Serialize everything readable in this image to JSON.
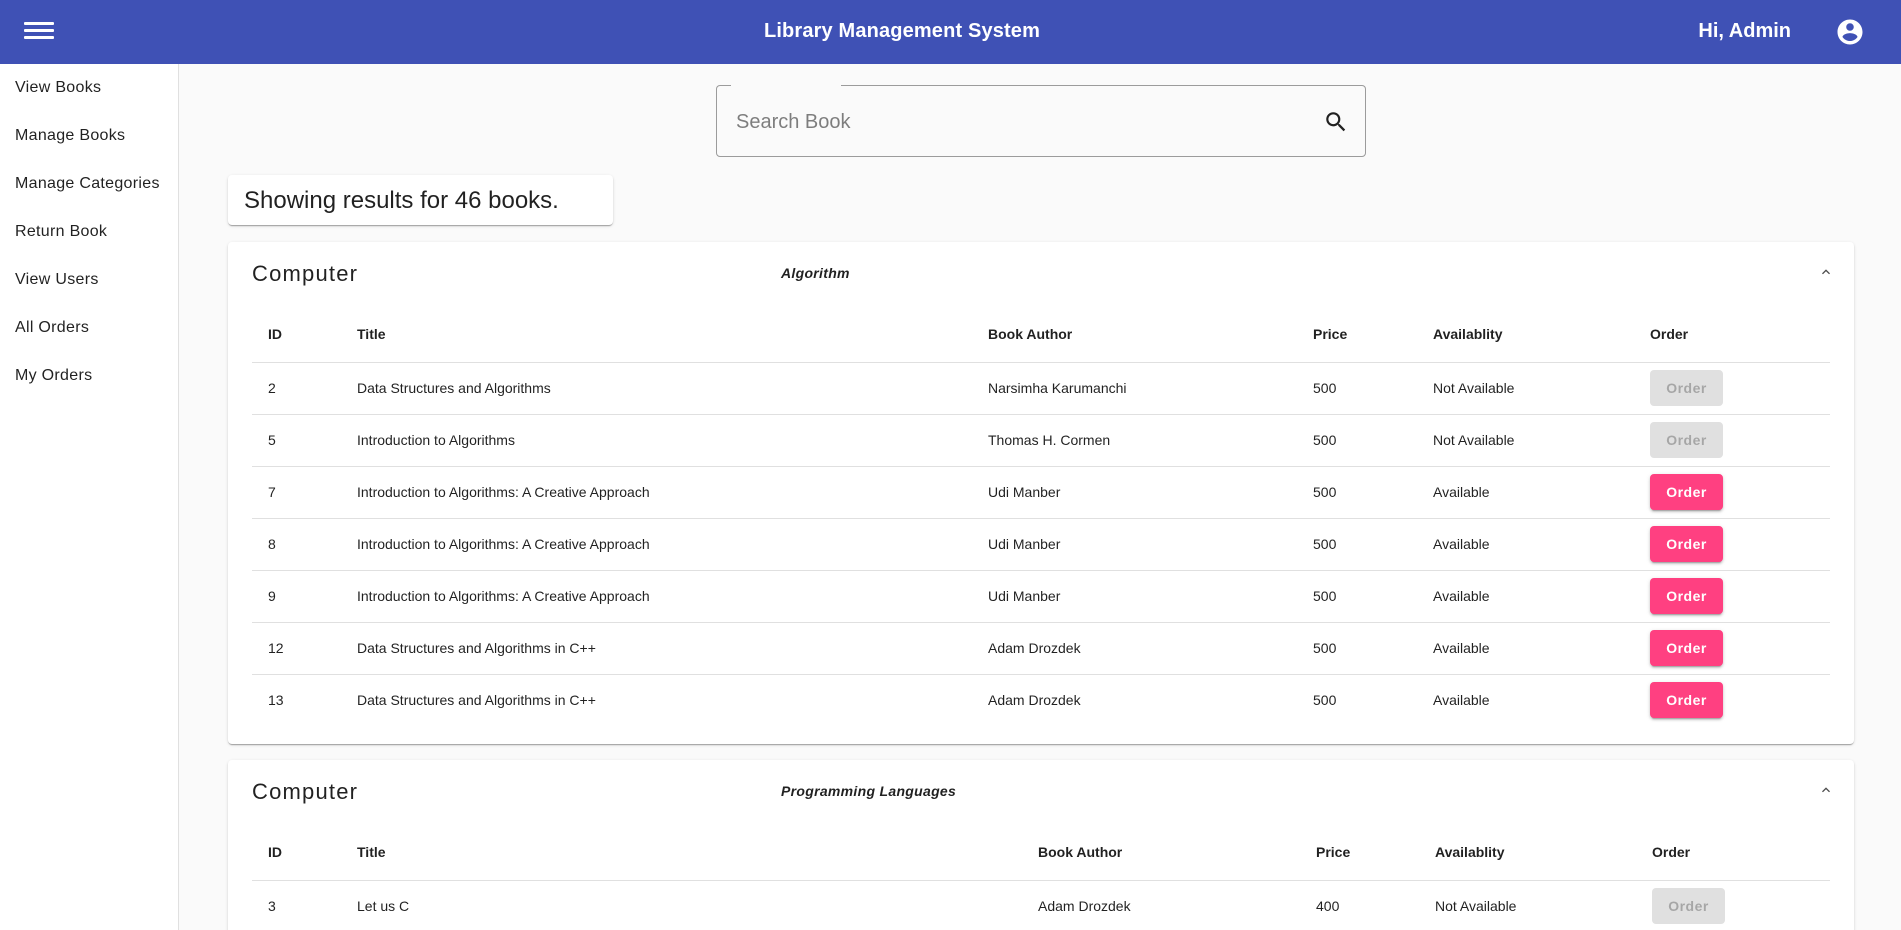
{
  "header": {
    "title": "Library Management System",
    "greeting": "Hi, Admin",
    "background": "#3f51b5"
  },
  "sidebar": {
    "items": [
      {
        "label": "View Books"
      },
      {
        "label": "Manage Books"
      },
      {
        "label": "Manage Categories"
      },
      {
        "label": "Return Book"
      },
      {
        "label": "View Users"
      },
      {
        "label": "All Orders"
      },
      {
        "label": "My Orders"
      }
    ]
  },
  "search": {
    "placeholder": "Search Book",
    "value": ""
  },
  "results": {
    "text": "Showing results for 46 books."
  },
  "sections": [
    {
      "category": "Computer",
      "subcategory": "Algorithm",
      "columns": [
        "ID",
        "Title",
        "Book Author",
        "Price",
        "Availablity",
        "Order"
      ],
      "rows": [
        {
          "id": "2",
          "title": "Data Structures and Algorithms",
          "author": "Narsimha Karumanchi",
          "price": "500",
          "availability": "Not Available",
          "order_label": "Order",
          "order_enabled": false
        },
        {
          "id": "5",
          "title": "Introduction to Algorithms",
          "author": "Thomas H. Cormen",
          "price": "500",
          "availability": "Not Available",
          "order_label": "Order",
          "order_enabled": false
        },
        {
          "id": "7",
          "title": "Introduction to Algorithms: A Creative Approach",
          "author": "Udi Manber",
          "price": "500",
          "availability": "Available",
          "order_label": "Order",
          "order_enabled": true
        },
        {
          "id": "8",
          "title": "Introduction to Algorithms: A Creative Approach",
          "author": "Udi Manber",
          "price": "500",
          "availability": "Available",
          "order_label": "Order",
          "order_enabled": true
        },
        {
          "id": "9",
          "title": "Introduction to Algorithms: A Creative Approach",
          "author": "Udi Manber",
          "price": "500",
          "availability": "Available",
          "order_label": "Order",
          "order_enabled": true
        },
        {
          "id": "12",
          "title": "Data Structures and Algorithms in C++",
          "author": "Adam Drozdek",
          "price": "500",
          "availability": "Available",
          "order_label": "Order",
          "order_enabled": true
        },
        {
          "id": "13",
          "title": "Data Structures and Algorithms in C++",
          "author": "Adam Drozdek",
          "price": "500",
          "availability": "Available",
          "order_label": "Order",
          "order_enabled": true
        }
      ]
    },
    {
      "category": "Computer",
      "subcategory": "Programming Languages",
      "columns": [
        "ID",
        "Title",
        "Book Author",
        "Price",
        "Availablity",
        "Order"
      ],
      "rows": [
        {
          "id": "3",
          "title": "Let us C",
          "author": "Adam Drozdek",
          "price": "400",
          "availability": "Not Available",
          "order_label": "Order",
          "order_enabled": false
        }
      ]
    }
  ],
  "colors": {
    "accent": "#ff4081",
    "disabled_button": "#e0e0e0"
  }
}
